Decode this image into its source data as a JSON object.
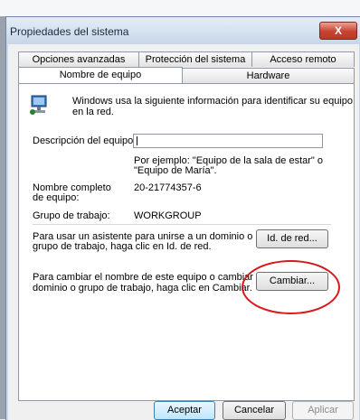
{
  "window": {
    "title": "Propiedades del sistema",
    "close_glyph": "X"
  },
  "tabs_row1": [
    "Opciones avanzadas",
    "Protección del sistema",
    "Acceso remoto"
  ],
  "tabs_row2": [
    "Nombre de equipo",
    "Hardware"
  ],
  "intro": {
    "line1": "Windows usa la siguiente información para identificar su equipo",
    "line2": "en la red."
  },
  "description": {
    "label": "Descripción del equipo:",
    "value": ""
  },
  "example": {
    "line1": "Por ejemplo: \"Equipo de la sala de estar\" o",
    "line2": "\"Equipo de María\"."
  },
  "fullname": {
    "label1": "Nombre completo",
    "label2": "de equipo:",
    "value": "20-21774357-6"
  },
  "workgroup": {
    "label": "Grupo de trabajo:",
    "value": "WORKGROUP"
  },
  "network": {
    "line1": "Para usar un asistente para unirse a un dominio o",
    "line2": "grupo de trabajo, haga clic en Id. de red.",
    "button": "Id. de red..."
  },
  "rename": {
    "line1": "Para cambiar el nombre de este equipo o cambiar el",
    "line2": "dominio o grupo de trabajo, haga clic en Cambiar.",
    "button": "Cambiar..."
  },
  "footer": {
    "ok": "Aceptar",
    "cancel": "Cancelar",
    "apply": "Aplicar"
  },
  "colors": {
    "annotation": "#d61a1a",
    "titlebar": "#c6d7ea"
  },
  "icons": [
    "computer-network-icon",
    "close-icon"
  ]
}
